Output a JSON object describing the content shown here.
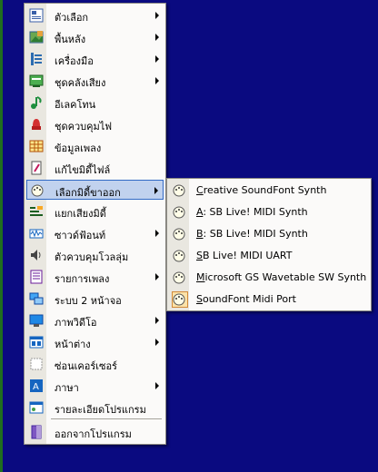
{
  "colors": {
    "desktop": "#0a0a80",
    "menu_bg": "#fbfaf9",
    "gutter": "#e9e7e0",
    "highlight": "#c1d2ee",
    "highlight_border": "#316ac5",
    "checked_bg": "#fbe2a8"
  },
  "main_menu": {
    "items": [
      {
        "label": "ตัวเลือก",
        "icon": "options-icon",
        "submenu": true
      },
      {
        "label": "พื้นหลัง",
        "icon": "background-icon",
        "submenu": true
      },
      {
        "label": "เครื่องมือ",
        "icon": "tools-icon",
        "submenu": true
      },
      {
        "label": "ชุดคลังเสียง",
        "icon": "sound-bank-icon",
        "submenu": true
      },
      {
        "label": "อีเลคโทน",
        "icon": "music-note-icon",
        "submenu": false
      },
      {
        "label": "ชุดควบคุมไฟ",
        "icon": "light-control-icon",
        "submenu": false
      },
      {
        "label": "ข้อมูลเพลง",
        "icon": "song-data-icon",
        "submenu": false
      },
      {
        "label": "แก้ไขมิดี้ไฟล์",
        "icon": "edit-midi-icon",
        "submenu": false
      },
      {
        "label": "เลือกมิดี้ขาออก",
        "icon": "midi-out-icon",
        "submenu": true
      },
      {
        "label": "แยกเสียงมิดี้",
        "icon": "split-midi-icon",
        "submenu": false
      },
      {
        "label": "ซาวด์ฟ้อนท์",
        "icon": "soundfont-icon",
        "submenu": true
      },
      {
        "label": "ตัวควบคุมโวลลุ่ม",
        "icon": "volume-icon",
        "submenu": false
      },
      {
        "label": "รายการเพลง",
        "icon": "playlist-icon",
        "submenu": true
      },
      {
        "label": "ระบบ 2 หน้าจอ",
        "icon": "dual-screen-icon",
        "submenu": false
      },
      {
        "label": "ภาพวิดีโอ",
        "icon": "video-icon",
        "submenu": true
      },
      {
        "label": "หน้าต่าง",
        "icon": "window-icon",
        "submenu": true
      },
      {
        "label": "ซ่อนเคอร์เซอร์",
        "icon": "hide-cursor-icon",
        "submenu": false
      },
      {
        "label": "ภาษา",
        "icon": "language-icon",
        "submenu": true
      },
      {
        "label": "รายละเอียดโปรแกรม",
        "icon": "about-icon",
        "submenu": false
      },
      {
        "label": "ออกจากโปรแกรม",
        "icon": "exit-icon",
        "submenu": false
      }
    ]
  },
  "midi_out_menu": {
    "items": [
      {
        "label": "Creative SoundFont Synth",
        "mnemonic": "C",
        "rest": "reative SoundFont Synth"
      },
      {
        "label": "A: SB Live! MIDI Synth",
        "mnemonic": "A",
        "rest": ": SB Live! MIDI Synth"
      },
      {
        "label": "B: SB Live! MIDI Synth",
        "mnemonic": "B",
        "rest": ": SB Live! MIDI Synth"
      },
      {
        "label": "SB Live! MIDI UART",
        "mnemonic": "S",
        "rest": "B Live! MIDI UART"
      },
      {
        "label": "Microsoft GS Wavetable SW Synth",
        "mnemonic": "M",
        "rest": "icrosoft GS Wavetable SW Synth"
      },
      {
        "label": "SoundFont Midi Port",
        "mnemonic": "S",
        "rest": "oundFont Midi Port",
        "checked": true
      }
    ]
  }
}
